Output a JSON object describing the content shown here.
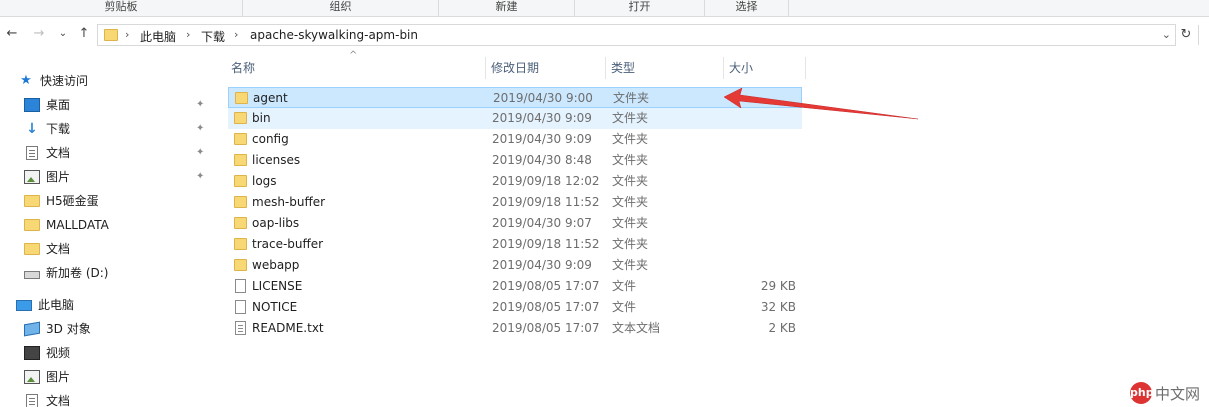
{
  "ribbon": {
    "groups": [
      "剪贴板",
      "组织",
      "新建",
      "打开",
      "选择"
    ]
  },
  "nav": {
    "back": "←",
    "forward": "→",
    "recent": "⌄",
    "up": "↑"
  },
  "address": {
    "crumbs": [
      "此电脑",
      "下载",
      "apache-skywalking-apm-bin"
    ],
    "separator": "›",
    "dropdown": "⌄",
    "refresh": "↻"
  },
  "sidebar": {
    "items": [
      {
        "label": "快速访问",
        "icon": "star-icon"
      },
      {
        "label": "桌面",
        "icon": "desktop-icon",
        "pinned": true
      },
      {
        "label": "下载",
        "icon": "download-icon",
        "pinned": true
      },
      {
        "label": "文档",
        "icon": "document-icon",
        "pinned": true
      },
      {
        "label": "图片",
        "icon": "pictures-icon",
        "pinned": true
      },
      {
        "label": "H5砸金蛋",
        "icon": "folder-icon"
      },
      {
        "label": "MALLDATA",
        "icon": "folder-icon"
      },
      {
        "label": "文档",
        "icon": "folder-icon"
      },
      {
        "label": "新加卷 (D:)",
        "icon": "drive-icon"
      },
      {
        "label": "此电脑",
        "icon": "computer-icon"
      },
      {
        "label": "3D 对象",
        "icon": "3d-objects-icon"
      },
      {
        "label": "视频",
        "icon": "videos-icon"
      },
      {
        "label": "图片",
        "icon": "pictures-icon"
      },
      {
        "label": "文档",
        "icon": "document-icon"
      }
    ],
    "pin_glyph": "📌"
  },
  "columns": {
    "name": "名称",
    "date": "修改日期",
    "type": "类型",
    "size": "大小",
    "sort_glyph": "^"
  },
  "files": [
    {
      "name": "agent",
      "date": "2019/04/30 9:00",
      "type": "文件夹",
      "size": "",
      "kind": "folder"
    },
    {
      "name": "bin",
      "date": "2019/04/30 9:09",
      "type": "文件夹",
      "size": "",
      "kind": "folder"
    },
    {
      "name": "config",
      "date": "2019/04/30 9:09",
      "type": "文件夹",
      "size": "",
      "kind": "folder"
    },
    {
      "name": "licenses",
      "date": "2019/04/30 8:48",
      "type": "文件夹",
      "size": "",
      "kind": "folder"
    },
    {
      "name": "logs",
      "date": "2019/09/18 12:02",
      "type": "文件夹",
      "size": "",
      "kind": "folder"
    },
    {
      "name": "mesh-buffer",
      "date": "2019/09/18 11:52",
      "type": "文件夹",
      "size": "",
      "kind": "folder"
    },
    {
      "name": "oap-libs",
      "date": "2019/04/30 9:07",
      "type": "文件夹",
      "size": "",
      "kind": "folder"
    },
    {
      "name": "trace-buffer",
      "date": "2019/09/18 11:52",
      "type": "文件夹",
      "size": "",
      "kind": "folder"
    },
    {
      "name": "webapp",
      "date": "2019/04/30 9:09",
      "type": "文件夹",
      "size": "",
      "kind": "folder"
    },
    {
      "name": "LICENSE",
      "date": "2019/08/05 17:07",
      "type": "文件",
      "size": "29 KB",
      "kind": "file"
    },
    {
      "name": "NOTICE",
      "date": "2019/08/05 17:07",
      "type": "文件",
      "size": "32 KB",
      "kind": "file"
    },
    {
      "name": "README.txt",
      "date": "2019/08/05 17:07",
      "type": "文本文档",
      "size": "2 KB",
      "kind": "text"
    }
  ],
  "selection": {
    "selected": "agent",
    "hovered": "bin"
  },
  "annotation": {
    "color": "#e53935"
  },
  "watermark": {
    "logo": "php",
    "text": "中文网"
  }
}
